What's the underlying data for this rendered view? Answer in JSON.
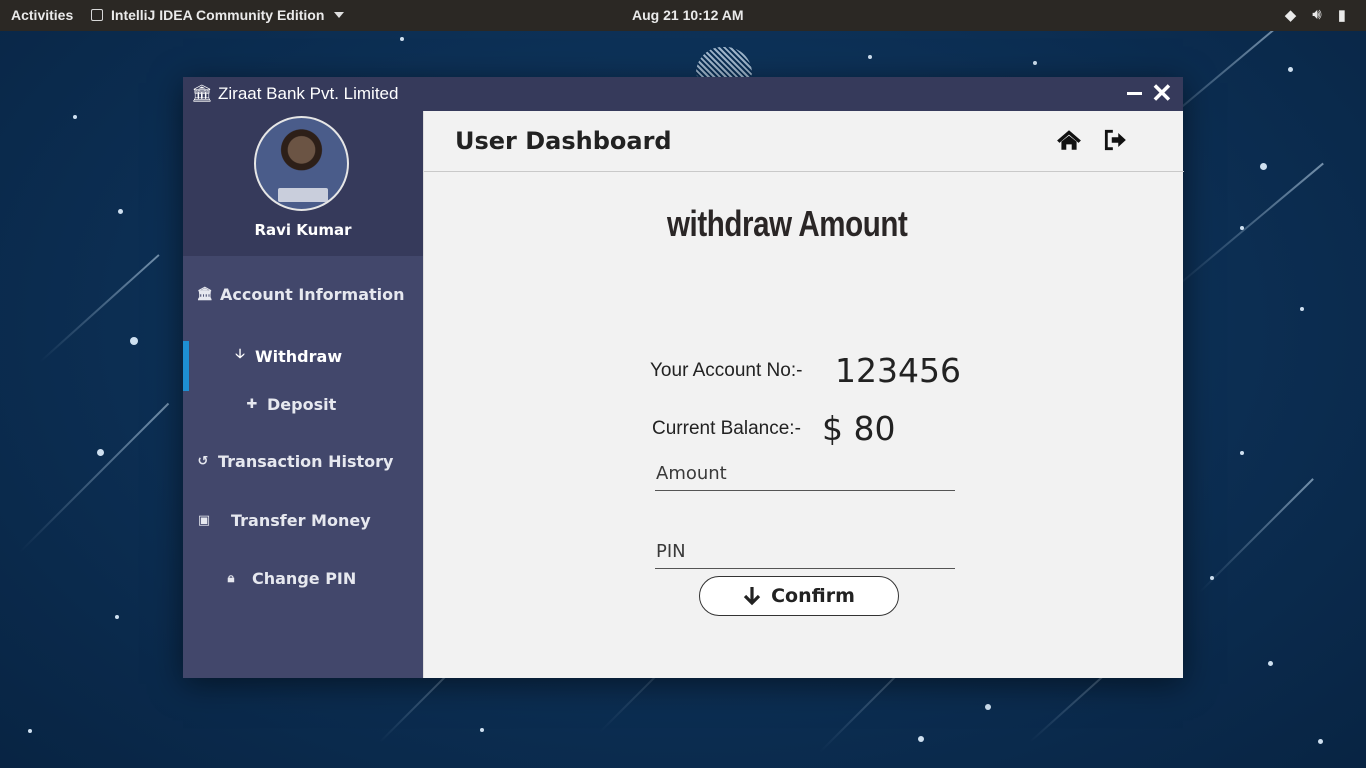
{
  "topbar": {
    "activities": "Activities",
    "app_name": "IntelliJ IDEA Community Edition",
    "clock": "Aug 21  10:12 AM"
  },
  "window": {
    "title": "Ziraat Bank Pvt. Limited"
  },
  "sidebar": {
    "user_name": "Ravi Kumar",
    "avatar_caption": "RAVI KUMAR",
    "items": [
      {
        "label": "Account Information",
        "icon": "bank-icon"
      },
      {
        "label": "Withdraw",
        "icon": "arrow-down-icon",
        "active": true
      },
      {
        "label": "Deposit",
        "icon": "plus-icon"
      },
      {
        "label": "Transaction History",
        "icon": "history-icon"
      },
      {
        "label": "Transfer Money",
        "icon": "money-icon"
      },
      {
        "label": "Change PIN",
        "icon": "lock-icon"
      }
    ]
  },
  "header": {
    "title": "User Dashboard"
  },
  "main": {
    "heading": "withdraw Amount",
    "account_label": "Your Account No:-",
    "account_number": "123456",
    "balance_label": "Current Balance:-",
    "balance_value": "$ 80",
    "amount_placeholder": "Amount",
    "pin_placeholder": "PIN",
    "confirm_label": "Confirm"
  },
  "colors": {
    "sidebar_bg": "#42476b",
    "titlebar_bg": "#363a5b",
    "active_marker": "#1e8fd3"
  }
}
